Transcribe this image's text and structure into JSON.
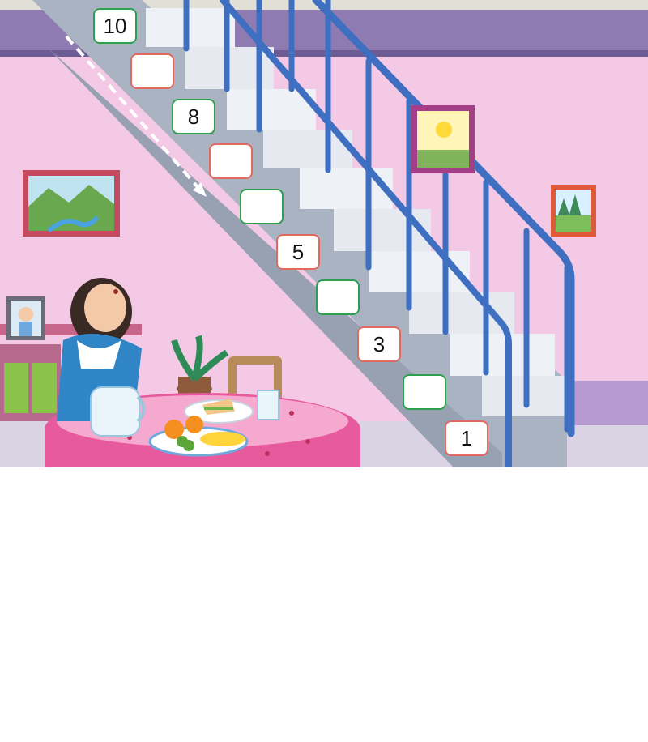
{
  "stair_boxes": [
    {
      "value": "10",
      "border": "green"
    },
    {
      "value": "",
      "border": "red"
    },
    {
      "value": "8",
      "border": "green"
    },
    {
      "value": "",
      "border": "red"
    },
    {
      "value": "",
      "border": "green"
    },
    {
      "value": "5",
      "border": "red"
    },
    {
      "value": "",
      "border": "green"
    },
    {
      "value": "3",
      "border": "red"
    },
    {
      "value": "",
      "border": "green"
    },
    {
      "value": "1",
      "border": "red"
    }
  ],
  "colors": {
    "wall": "#f3c9e6",
    "ceiling_band": "#8e7bb2",
    "stair_side": "#a9b3c2",
    "step": "#eef1f5",
    "rail": "#3f6fc0",
    "box_red": "#e06a5d",
    "box_green": "#2e9e4f",
    "tablecloth": "#e85a9e"
  },
  "icons": [
    "dashed-arrow-icon",
    "landscape-painting",
    "sun-painting",
    "tree-painting",
    "portrait-frame",
    "plant",
    "chair",
    "water-jug",
    "water-glass",
    "fruit-plate",
    "sandwich-plate"
  ]
}
